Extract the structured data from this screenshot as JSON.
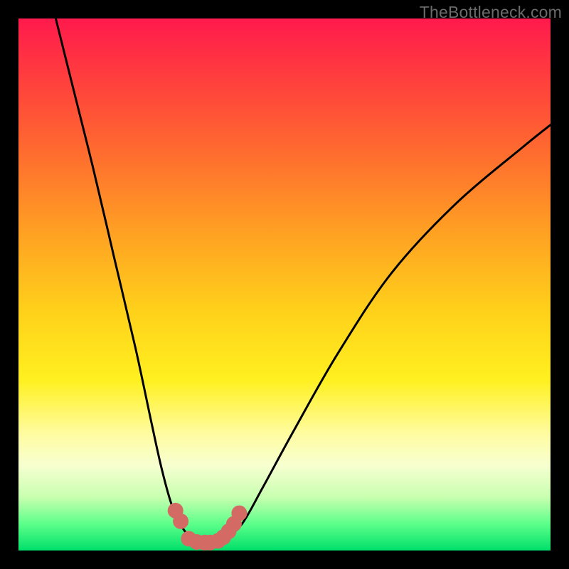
{
  "watermark": "TheBottleneck.com",
  "chart_data": {
    "type": "line",
    "title": "",
    "xlabel": "",
    "ylabel": "",
    "xlim": [
      0,
      100
    ],
    "ylim": [
      0,
      100
    ],
    "series": [
      {
        "name": "bottleneck-curve",
        "x": [
          7,
          10,
          14,
          18,
          22,
          25,
          27,
          29,
          31,
          33,
          35,
          36.5,
          38.5,
          42,
          46,
          52,
          60,
          70,
          82,
          95,
          100
        ],
        "values": [
          100,
          88,
          72,
          55,
          38,
          24,
          15,
          8,
          4,
          2,
          1.5,
          1.5,
          2,
          5,
          12,
          23,
          37,
          52,
          65,
          76,
          80
        ]
      }
    ],
    "markers": {
      "name": "highlight-dots",
      "color": "#d36a63",
      "points": [
        {
          "x": 29.5,
          "y": 7.5
        },
        {
          "x": 30.5,
          "y": 5.5
        },
        {
          "x": 32.0,
          "y": 2.2
        },
        {
          "x": 33.5,
          "y": 1.6
        },
        {
          "x": 35.0,
          "y": 1.5
        },
        {
          "x": 36.0,
          "y": 1.5
        },
        {
          "x": 37.5,
          "y": 1.8
        },
        {
          "x": 38.5,
          "y": 2.5
        },
        {
          "x": 39.5,
          "y": 3.6
        },
        {
          "x": 40.5,
          "y": 5.0
        },
        {
          "x": 41.5,
          "y": 7.0
        }
      ]
    }
  }
}
